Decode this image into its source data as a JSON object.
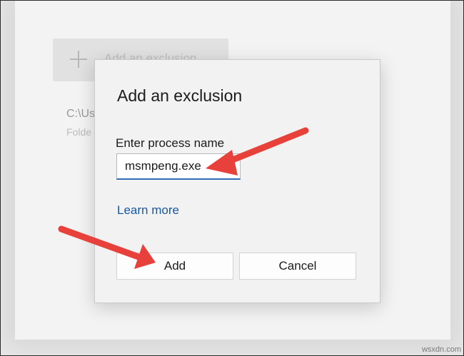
{
  "background": {
    "add_button_label": "Add an exclusion",
    "exclusion_path": "C:\\Us",
    "exclusion_type": "Folde"
  },
  "dialog": {
    "title": "Add an exclusion",
    "field_label": "Enter process name",
    "field_value": "msmpeng.exe",
    "learn_more": "Learn more",
    "add_label": "Add",
    "cancel_label": "Cancel"
  },
  "annotations": {
    "arrow_color": "#e8413b"
  },
  "watermark": "wsxdn.com",
  "colors": {
    "link": "#1a58a3",
    "input_focus_underline": "#2f6db5",
    "dialog_bg": "#f2f2f2"
  }
}
